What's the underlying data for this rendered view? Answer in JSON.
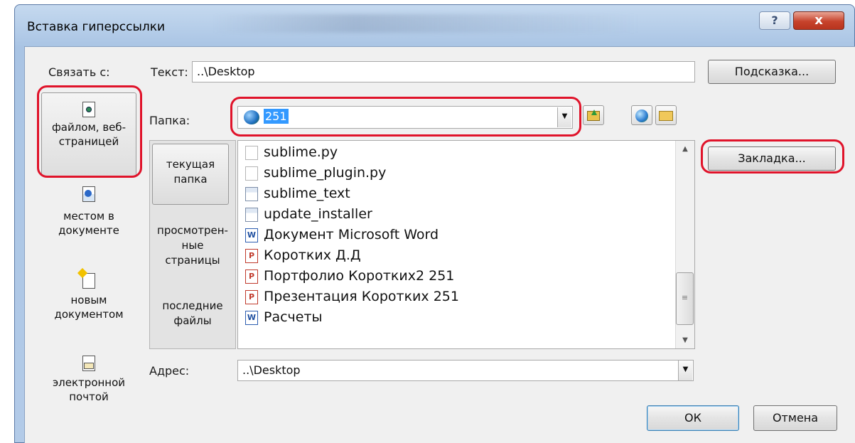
{
  "window": {
    "title": "Вставка гиперссылки",
    "help_label": "?",
    "close_label": "x"
  },
  "link_to": {
    "label": "Связать с:",
    "items": [
      {
        "line1": "файлом, веб-",
        "line2": "страницей",
        "icon": "file-web-icon"
      },
      {
        "line1": "местом в",
        "line2": "документе",
        "icon": "place-in-document-icon"
      },
      {
        "line1": "новым",
        "line2": "документом",
        "icon": "new-document-icon"
      },
      {
        "line1": "электронной",
        "line2": "почтой",
        "icon": "email-icon"
      }
    ]
  },
  "text_field": {
    "label": "Текст:",
    "value": "..\\Desktop"
  },
  "screentip_button": "Подсказка...",
  "folder": {
    "label": "Папка:",
    "value": "251"
  },
  "bookmark_button": "Закладка...",
  "sub_nav": [
    {
      "line1": "текущая",
      "line2": "папка"
    },
    {
      "line1": "просмотрен-",
      "line2": "ные",
      "line3": "страницы"
    },
    {
      "line1": "последние",
      "line2": "файлы"
    }
  ],
  "files": [
    {
      "name": "sublime.py",
      "type": "py"
    },
    {
      "name": "sublime_plugin.py",
      "type": "py"
    },
    {
      "name": "sublime_text",
      "type": "exe"
    },
    {
      "name": "update_installer",
      "type": "exe"
    },
    {
      "name": "Документ Microsoft Word",
      "type": "word"
    },
    {
      "name": "Коротких Д.Д",
      "type": "ppt"
    },
    {
      "name": "Портфолио Коротких2 251",
      "type": "ppt"
    },
    {
      "name": "Презентация Коротких 251",
      "type": "ppt"
    },
    {
      "name": "Расчеты",
      "type": "word"
    }
  ],
  "address": {
    "label": "Адрес:",
    "value": "..\\Desktop"
  },
  "ok_button": "ОК",
  "cancel_button": "Отмена",
  "colors": {
    "highlight_outline": "#e0132a",
    "selection": "#3399ff"
  }
}
